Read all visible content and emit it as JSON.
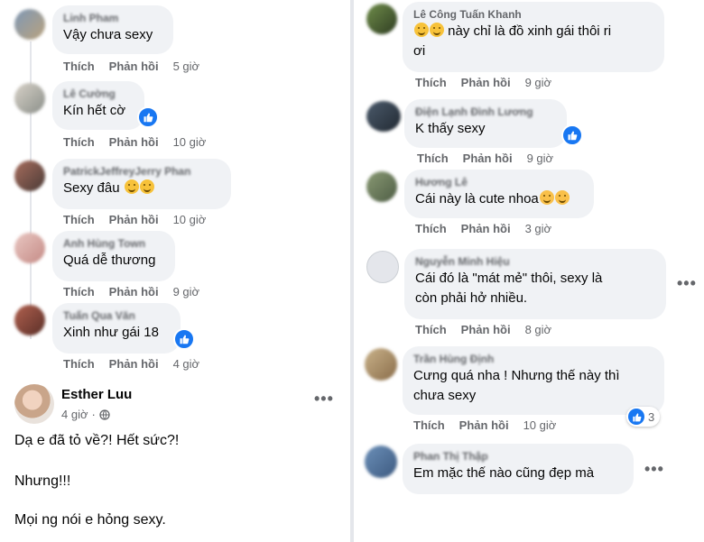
{
  "actions": {
    "like": "Thích",
    "reply": "Phản hồi"
  },
  "left_comments": [
    {
      "name": "Linh Pham",
      "text": "Vậy chưa sexy",
      "time": "5 giờ"
    },
    {
      "name": "Lê Cường",
      "text": "Kín hết cờ",
      "time": "10 giờ"
    },
    {
      "name": "PatrickJeffreyJerry Phan",
      "text": "Sexy đâu",
      "time": "10 giờ"
    },
    {
      "name": "Anh Hùng Town",
      "text": "Quá dễ thương",
      "time": "9 giờ"
    },
    {
      "name": "Tuấn Qua Văn",
      "text": "Xinh như gái 18",
      "time": "4 giờ"
    }
  ],
  "post": {
    "author": "Esther Luu",
    "time": "4 giờ",
    "lines": [
      "Dạ e đã tỏ về?! Hết sức?!",
      "Nhưng!!!",
      "Mọi ng nói e hỏng sexy."
    ]
  },
  "right_comments": [
    {
      "name": "Lê Công Tuấn Khanh",
      "text_line1": "này chỉ là đồ xinh gái thôi ri",
      "text_line2": "ơi",
      "time": "9 giờ"
    },
    {
      "name": "Điện Lạnh Đình Lương",
      "text": "K thấy sexy",
      "time": "9 giờ"
    },
    {
      "name": "Hương Lê",
      "text": "Cái này là cute nhoa",
      "time": "3 giờ"
    },
    {
      "name": "Nguyễn Minh Hiệu",
      "text_line1": "Cái đó là \"mát mẻ\" thôi, sexy là",
      "text_line2": "còn phải hở nhiều.",
      "time": "8 giờ"
    },
    {
      "name": "Trần Hùng Định",
      "text_line1": "Cưng quá nha ! Nhưng thế này thì",
      "text_line2": "chưa sexy",
      "time": "10 giờ",
      "reactions": "3"
    },
    {
      "name": "Phan Thị Thập",
      "text": "Em mặc thế nào cũng đẹp mà"
    }
  ],
  "icons": {
    "like": "thumbs-up-icon",
    "more": "more-options-icon",
    "globe": "globe-icon",
    "emoji": "smiley-emoji-icon"
  },
  "colors": {
    "bubble": "#f0f2f5",
    "like_blue": "#1877f2",
    "meta_gray": "#65676b",
    "text": "#050505"
  }
}
